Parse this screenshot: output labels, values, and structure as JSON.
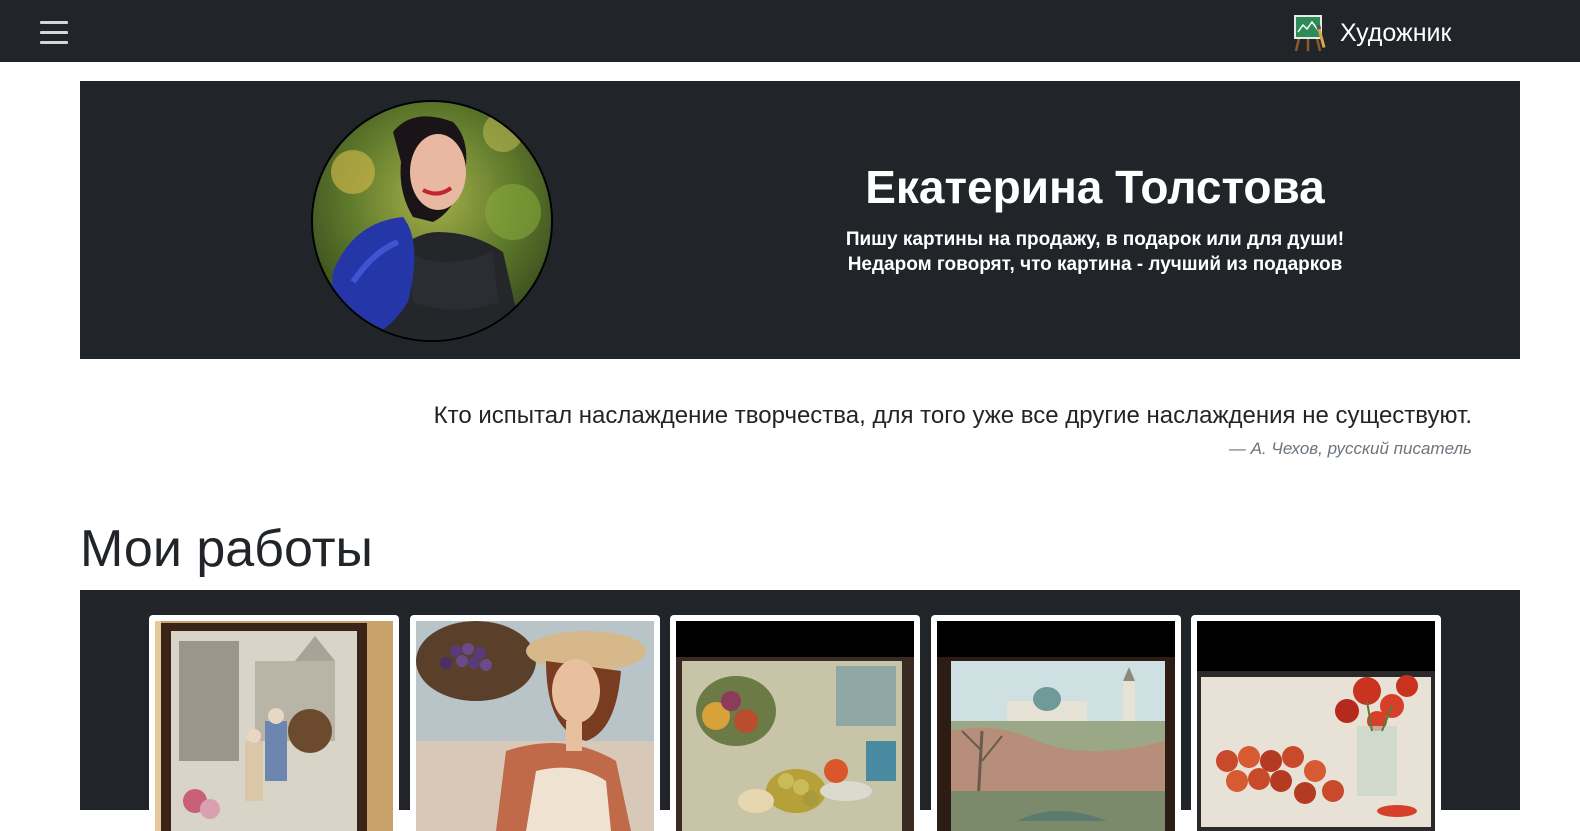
{
  "navbar": {
    "menu_icon": "hamburger-menu-icon",
    "brand_icon": "easel-painting-icon",
    "brand_text": "Художник"
  },
  "hero": {
    "name": "Екатерина Толстова",
    "subtitle_line1": "Пишу картины на продажу, в подарок или для души!",
    "subtitle_line2": "Недаром говорят, что картина - лучший из подарков",
    "avatar_alt": "Екатерина Толстова"
  },
  "quote": {
    "text": "Кто испытал наслаждение творчества, для того уже все другие наслаждения не существуют.",
    "author": "— А. Чехов, русский писатель"
  },
  "works": {
    "title": "Мои работы",
    "items": [
      {
        "image": "framed-painting-street-scene"
      },
      {
        "image": "painting-woman-with-grapes-basket"
      },
      {
        "image": "painting-still-life-fruits"
      },
      {
        "image": "painting-landscape-church"
      },
      {
        "image": "painting-red-roses-apples"
      }
    ]
  },
  "colors": {
    "dark": "#212529",
    "white": "#ffffff",
    "muted": "#6c757d"
  }
}
